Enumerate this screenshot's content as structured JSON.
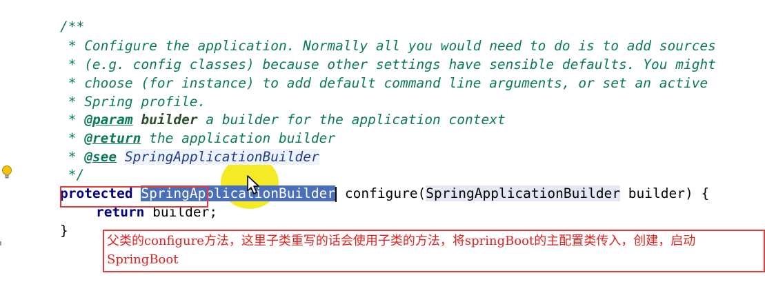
{
  "code": {
    "doc_open": "/**",
    "doc_line1": " * Configure the application. Normally all you would need to do is to add sources",
    "doc_line2": " * (e.g. config classes) because other settings have sensible defaults. You might",
    "doc_line3": " * choose (for instance) to add default command line arguments, or set an active",
    "doc_line4": " * Spring profile.",
    "param_prefix": " * ",
    "param_tag": "@param",
    "param_name": "builder",
    "param_desc": " a builder for the application context",
    "return_prefix": " * ",
    "return_tag": "@return",
    "return_desc": " the application builder",
    "see_prefix": " * ",
    "see_tag": "@see",
    "see_ref": "SpringApplicationBuilder",
    "doc_close": " */",
    "method_modifier": "protected",
    "method_return_type": "SpringApplicationBuilder",
    "method_name": " configure(",
    "param_type": "SpringApplicationBuilder",
    "param_var": " builder) {",
    "return_kw": "return",
    "return_value": " builder;",
    "close_brace": "}"
  },
  "annotation": {
    "text": "父类的configure方法，这里子类重写的话会使用子类的方法，将springBoot的主配置类传入，创建，启动SpringBoot"
  },
  "colors": {
    "doc_comment": "#0b7a5a",
    "keyword": "#000080",
    "selection": "#4a6fb8",
    "annotation_red": "#e63b3b",
    "cursor_highlight": "#f3e600"
  },
  "icons": {
    "gutter": "lightbulb-icon",
    "mouse": "mouse-pointer-icon"
  }
}
